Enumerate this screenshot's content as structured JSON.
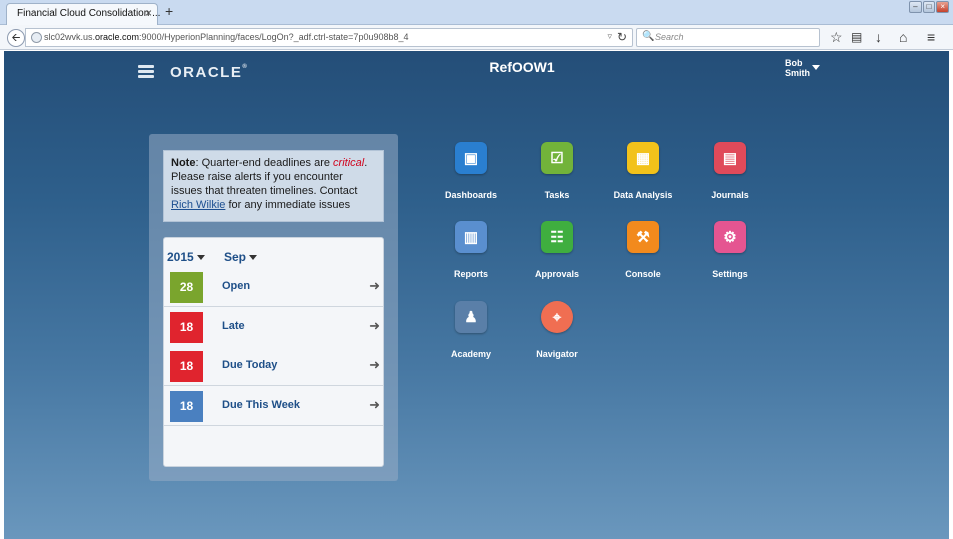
{
  "browser": {
    "tab_title": "Financial Cloud Consolidation ...",
    "tab_close": "×",
    "new_tab": "+",
    "url_prefix": "slc02wvk.us.",
    "url_host": "oracle.com",
    "url_rest": ":9000/HyperionPlanning/faces/LogOn?_adf.ctrl-state=7p0u908b8_4",
    "search_placeholder": "Search"
  },
  "header": {
    "logo_text": "ORACLE",
    "app_title": "RefOOW1",
    "user_first": "Bob",
    "user_last": "Smith"
  },
  "note": {
    "label": "Note",
    "text1": ": Quarter-end deadlines are ",
    "critical": "critical",
    "text2": ". Please raise alerts if you encounter issues that threaten timelines. Contact ",
    "contact": "Rich Wilkie",
    "text3": " for any immediate issues"
  },
  "period": {
    "year": "2015",
    "month": "Sep"
  },
  "status_rows": [
    {
      "count": "28",
      "label": "Open",
      "color": "#7aa52d"
    },
    {
      "count": "18",
      "label": "Late",
      "color": "#e0242e"
    },
    {
      "count": "18",
      "label": "Due Today",
      "color": "#e0242e"
    },
    {
      "count": "18",
      "label": "Due This Week",
      "color": "#4a80c0"
    }
  ],
  "tiles": [
    {
      "label": "Dashboards",
      "icon": "dashboard-icon",
      "glyph": "▣",
      "color": "#2a7fd0"
    },
    {
      "label": "Tasks",
      "icon": "tasks-icon",
      "glyph": "☑",
      "color": "#72b33a"
    },
    {
      "label": "Data Analysis",
      "icon": "data-analysis-icon",
      "glyph": "▦",
      "color": "#f2c21b"
    },
    {
      "label": "Journals",
      "icon": "journals-icon",
      "glyph": "▤",
      "color": "#e04a5a"
    },
    {
      "label": "Reports",
      "icon": "reports-icon",
      "glyph": "▥",
      "color": "#5a8fcf"
    },
    {
      "label": "Approvals",
      "icon": "approvals-icon",
      "glyph": "☷",
      "color": "#3fae3f"
    },
    {
      "label": "Console",
      "icon": "console-icon",
      "glyph": "⚒",
      "color": "#f28a1d"
    },
    {
      "label": "Settings",
      "icon": "settings-icon",
      "glyph": "⚙",
      "color": "#e55591"
    },
    {
      "label": "Academy",
      "icon": "academy-icon",
      "glyph": "♟",
      "color": "#5a7fa8"
    },
    {
      "label": "Navigator",
      "icon": "navigator-icon",
      "glyph": "⌖",
      "color": "#f06e52"
    }
  ]
}
